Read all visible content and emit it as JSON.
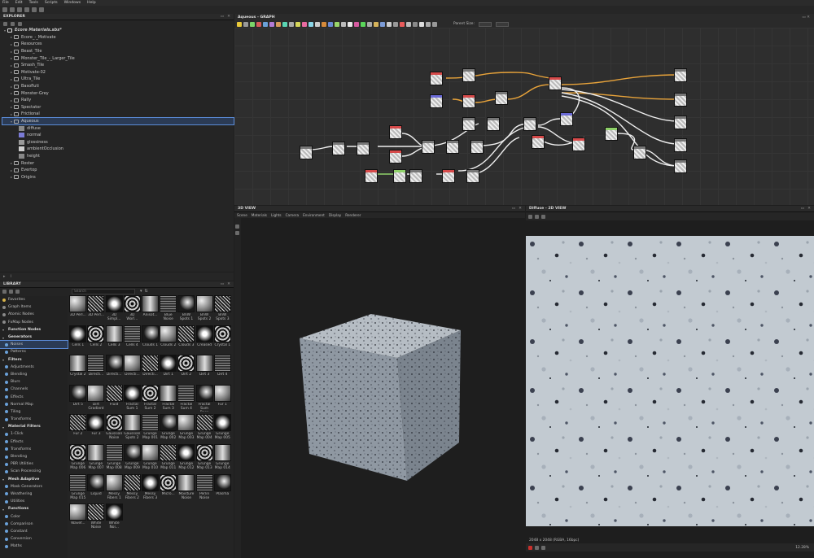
{
  "menu": [
    "File",
    "Edit",
    "Tools",
    "Scripts",
    "Windows",
    "Help"
  ],
  "explorer": {
    "title": "EXPLORER",
    "package": "Ecore Materials.sbs*",
    "items": [
      "Ecore_-_Motivate",
      "Resources",
      "Beast_Tile",
      "Monster_Tile_-_Larger_Tile",
      "Smash_Tile",
      "Motivate-02",
      "Ultra_Tile",
      "Basofluti",
      "Monster-Grey",
      "Rally",
      "Spectator",
      "Frictional",
      "Aqueous",
      "Roster",
      "Evertop",
      "Origins"
    ],
    "outputs": [
      {
        "name": "diffuse",
        "color": "#8a8a8a"
      },
      {
        "name": "normal",
        "color": "#7b7bd6"
      },
      {
        "name": "glossiness",
        "color": "#9a9a9a"
      },
      {
        "name": "ambientOcclusion",
        "color": "#cfcfcf"
      },
      {
        "name": "height",
        "color": "#888888"
      }
    ]
  },
  "graph": {
    "title": "Aqueous - GRAPH",
    "parent_size_label": "Parent Size:"
  },
  "view3d": {
    "title": "3D VIEW",
    "menu": [
      "Scene",
      "Materials",
      "Lights",
      "Camera",
      "Environment",
      "Display",
      "Renderer"
    ]
  },
  "view2d": {
    "title": "Diffuse - 2D VIEW",
    "status": "2048 x 2048 (RGBA, 16bpc)",
    "zoom": "12.28%"
  },
  "library": {
    "title": "LIBRARY",
    "search_placeholder": "Search",
    "nav": [
      {
        "label": "Favorites",
        "type": "item",
        "dot": "#d6b24a"
      },
      {
        "label": "Graph Items",
        "type": "item",
        "dot": "#8a8a8a"
      },
      {
        "label": "Atomic Nodes",
        "type": "item",
        "dot": "#8a8a8a"
      },
      {
        "label": "FxMap Nodes",
        "type": "item",
        "dot": "#8a8a8a"
      },
      {
        "label": "Function Nodes",
        "type": "cat"
      },
      {
        "label": "Generators",
        "type": "cat"
      },
      {
        "label": "Noises",
        "type": "sel",
        "dot": "#6aa0d8"
      },
      {
        "label": "Patterns",
        "type": "sub",
        "dot": "#6aa0d8"
      },
      {
        "label": "Filters",
        "type": "cat"
      },
      {
        "label": "Adjustments",
        "type": "sub",
        "dot": "#6aa0d8"
      },
      {
        "label": "Blending",
        "type": "sub",
        "dot": "#6aa0d8"
      },
      {
        "label": "Blurs",
        "type": "sub",
        "dot": "#6aa0d8"
      },
      {
        "label": "Channels",
        "type": "sub",
        "dot": "#6aa0d8"
      },
      {
        "label": "Effects",
        "type": "sub",
        "dot": "#6aa0d8"
      },
      {
        "label": "Normal Map",
        "type": "sub",
        "dot": "#6aa0d8"
      },
      {
        "label": "Tiling",
        "type": "sub",
        "dot": "#6aa0d8"
      },
      {
        "label": "Transforms",
        "type": "sub",
        "dot": "#6aa0d8"
      },
      {
        "label": "Material Filters",
        "type": "cat"
      },
      {
        "label": "1-Click",
        "type": "sub",
        "dot": "#6aa0d8"
      },
      {
        "label": "Effects",
        "type": "sub",
        "dot": "#6aa0d8"
      },
      {
        "label": "Transforms",
        "type": "sub",
        "dot": "#6aa0d8"
      },
      {
        "label": "Blending",
        "type": "sub",
        "dot": "#6aa0d8"
      },
      {
        "label": "PBR Utilities",
        "type": "sub",
        "dot": "#6aa0d8"
      },
      {
        "label": "Scan Processing",
        "type": "sub",
        "dot": "#6aa0d8"
      },
      {
        "label": "Mesh Adaptive",
        "type": "cat"
      },
      {
        "label": "Mask Generators",
        "type": "sub",
        "dot": "#6aa0d8"
      },
      {
        "label": "Weathering",
        "type": "sub",
        "dot": "#6aa0d8"
      },
      {
        "label": "Utilities",
        "type": "sub",
        "dot": "#6aa0d8"
      },
      {
        "label": "Functions",
        "type": "cat"
      },
      {
        "label": "Color",
        "type": "sub",
        "dot": "#6aa0d8"
      },
      {
        "label": "Comparison",
        "type": "sub",
        "dot": "#6aa0d8"
      },
      {
        "label": "Constant",
        "type": "sub",
        "dot": "#6aa0d8"
      },
      {
        "label": "Conversion",
        "type": "sub",
        "dot": "#6aa0d8"
      },
      {
        "label": "Maths",
        "type": "sub",
        "dot": "#6aa0d8"
      }
    ],
    "tiles": [
      "3D Perl...",
      "3D Perl...",
      "3D Simpl...",
      "3D Worl...",
      "Anisot...",
      "Blue Noise",
      "BnW Spots 1",
      "BnW Spots 2",
      "BnW Spots 3",
      "Cells 1",
      "Cells 2",
      "Cells 3",
      "Cells 4",
      "Clouds 1",
      "Clouds 2",
      "Clouds 3",
      "Creased",
      "Crystal 1",
      "Crystal 2",
      "Directi...",
      "Directi...",
      "Directi...",
      "Directi...",
      "Dirt 1",
      "Dirt 2",
      "Dirt 3",
      "Dirt 4",
      "Dirt 5",
      "Dirt Gradient",
      "Fluid",
      "Fractal Sum 1",
      "Fractal Sum 2",
      "Fractal Sum 3",
      "Fractal Sum 4",
      "Fractal Sum Base",
      "Fur 1",
      "Fur 2",
      "Fur 3",
      "Gaussian Noise",
      "Gaussian Spots 2",
      "Grunge Map 001",
      "Grunge Map 002",
      "Grunge Map 003",
      "Grunge Map 004",
      "Grunge Map 005",
      "Grunge Map 006",
      "Grunge Map 007",
      "Grunge Map 008",
      "Grunge Map 009",
      "Grunge Map 010",
      "Grunge Map 011",
      "Grunge Map 012",
      "Grunge Map 013",
      "Grunge Map 014",
      "Grunge Map 015",
      "Liquid",
      "Messy Fibers 1",
      "Messy Fibers 2",
      "Messy Fibers 3",
      "Micro...",
      "Moisture Noise",
      "Perlin Noise",
      "Plasma",
      "Wavef...",
      "White Noise",
      "White Noi..."
    ]
  }
}
